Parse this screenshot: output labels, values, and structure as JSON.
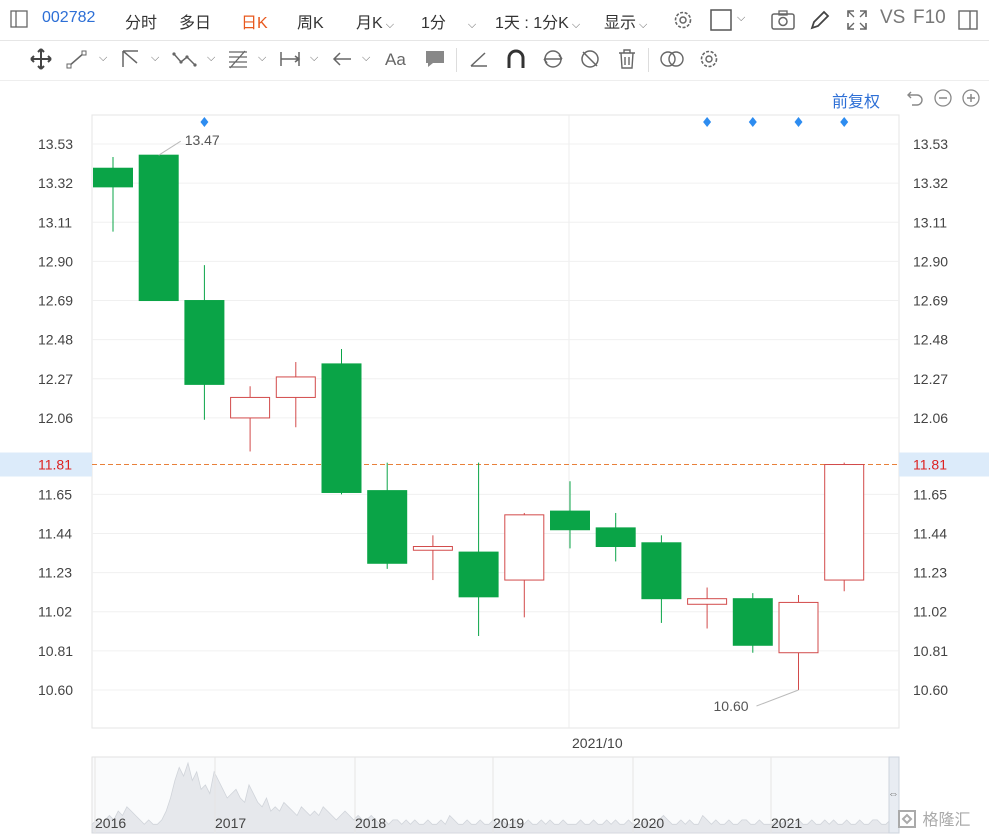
{
  "toolbar": {
    "code": "002782",
    "tabs": [
      "分时",
      "多日",
      "日K",
      "周K",
      "月K",
      "1分",
      "1天 : 1分K",
      "显示"
    ],
    "vs": "VS",
    "f10": "F10"
  },
  "fuquan_label": "前复权",
  "colors": {
    "up": "#d24a4a",
    "down": "#0aa447",
    "accent": "#2d6fd6",
    "current_line": "#e8803a"
  },
  "chart_data": {
    "type": "candlestick",
    "ylim": [
      10.6,
      13.53
    ],
    "y_ticks": [
      "13.53",
      "13.32",
      "13.11",
      "12.90",
      "12.69",
      "12.48",
      "12.27",
      "12.06",
      "11.65",
      "11.44",
      "11.23",
      "11.02",
      "10.81",
      "10.60"
    ],
    "current_price": "11.81",
    "candles": [
      {
        "open": 13.4,
        "close": 13.3,
        "high": 13.46,
        "low": 13.06
      },
      {
        "open": 13.47,
        "close": 12.69,
        "high": 13.47,
        "low": 12.69
      },
      {
        "open": 12.69,
        "close": 12.24,
        "high": 12.88,
        "low": 12.05
      },
      {
        "open": 12.06,
        "close": 12.17,
        "high": 12.23,
        "low": 11.88
      },
      {
        "open": 12.17,
        "close": 12.28,
        "high": 12.36,
        "low": 12.01
      },
      {
        "open": 12.35,
        "close": 11.66,
        "high": 12.43,
        "low": 11.65
      },
      {
        "open": 11.67,
        "close": 11.28,
        "high": 11.82,
        "low": 11.25
      },
      {
        "open": 11.35,
        "close": 11.37,
        "high": 11.43,
        "low": 11.19
      },
      {
        "open": 11.34,
        "close": 11.1,
        "high": 11.82,
        "low": 10.89
      },
      {
        "open": 11.19,
        "close": 11.54,
        "high": 11.55,
        "low": 10.99
      },
      {
        "open": 11.56,
        "close": 11.46,
        "high": 11.72,
        "low": 11.36
      },
      {
        "open": 11.47,
        "close": 11.37,
        "high": 11.55,
        "low": 11.29
      },
      {
        "open": 11.39,
        "close": 11.09,
        "high": 11.43,
        "low": 10.96
      },
      {
        "open": 11.06,
        "close": 11.09,
        "high": 11.15,
        "low": 10.93
      },
      {
        "open": 11.09,
        "close": 10.84,
        "high": 11.12,
        "low": 10.8
      },
      {
        "open": 10.8,
        "close": 11.07,
        "high": 11.11,
        "low": 10.6
      },
      {
        "open": 11.19,
        "close": 11.81,
        "high": 11.82,
        "low": 11.13
      }
    ],
    "annotations": {
      "high": {
        "label": "13.47",
        "candle": 1
      },
      "low": {
        "label": "10.60",
        "candle": 15
      }
    },
    "event_markers": [
      2,
      13,
      14,
      15,
      16
    ],
    "crosshair_label": "2021/10",
    "navigator_years": [
      "2016",
      "2017",
      "2018",
      "2019",
      "2020",
      "2021"
    ],
    "navigator_volume": [
      2,
      3,
      2,
      3,
      4,
      3,
      5,
      4,
      6,
      5,
      4,
      3,
      2,
      3,
      2,
      2,
      3,
      5,
      8,
      12,
      15,
      13,
      16,
      12,
      14,
      10,
      11,
      9,
      14,
      12,
      10,
      8,
      9,
      10,
      8,
      7,
      11,
      9,
      7,
      6,
      8,
      5,
      6,
      5,
      7,
      6,
      5,
      4,
      6,
      5,
      4,
      5,
      4,
      6,
      5,
      4,
      3,
      4,
      5,
      4,
      3,
      4,
      3,
      3,
      4,
      3,
      2,
      3,
      2,
      3,
      3,
      2,
      3,
      2,
      3,
      2,
      2,
      3,
      2,
      2,
      3,
      2,
      4,
      3,
      2,
      2,
      3,
      2,
      2,
      3,
      2,
      2,
      3,
      2,
      3,
      2,
      2,
      3,
      2,
      2,
      3,
      2,
      2,
      3,
      2,
      3,
      2,
      2,
      3,
      2,
      2,
      2,
      3,
      2,
      2,
      3,
      2,
      2,
      3,
      2,
      3,
      2,
      2,
      3,
      2,
      2,
      2,
      3,
      2,
      2,
      3,
      4,
      3,
      2,
      2,
      3,
      2,
      3,
      2,
      2,
      4,
      3,
      2,
      3,
      2,
      2,
      3,
      2,
      2,
      3,
      3,
      2,
      2,
      3,
      2,
      2,
      2,
      3,
      2,
      3,
      2,
      2,
      3,
      2,
      2,
      3,
      2,
      2,
      3,
      2,
      3,
      2,
      2,
      3,
      2,
      2,
      3,
      2,
      2,
      3,
      3,
      2,
      2,
      3,
      2,
      2
    ]
  },
  "watermark": "格隆汇"
}
